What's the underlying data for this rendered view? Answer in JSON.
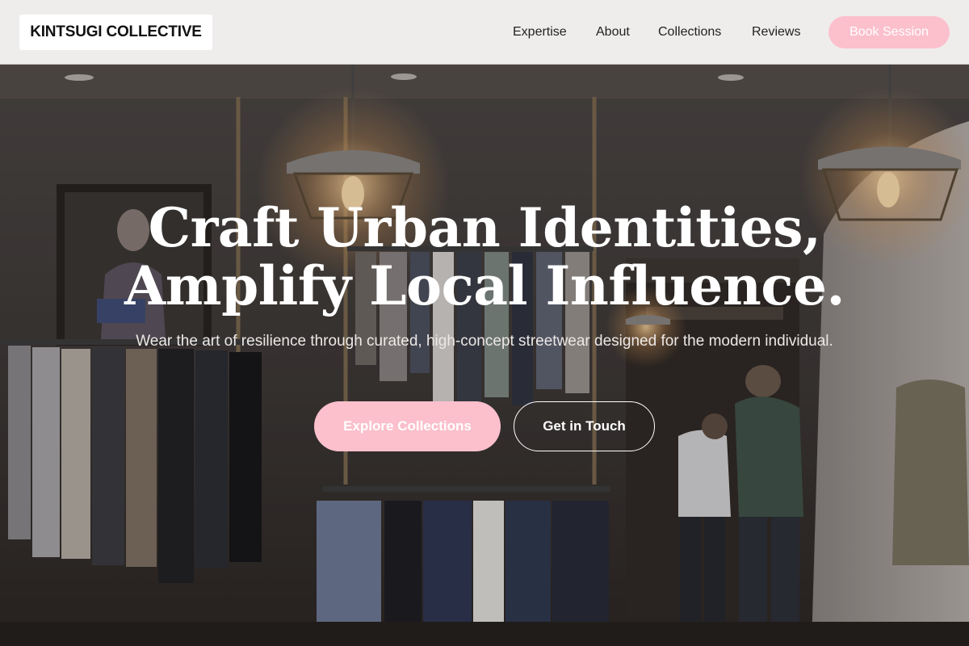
{
  "header": {
    "logo_text": "KINTSUGI COLLECTIVE",
    "nav": [
      {
        "label": "Expertise"
      },
      {
        "label": "About"
      },
      {
        "label": "Collections"
      },
      {
        "label": "Reviews"
      }
    ],
    "cta_label": "Book Session"
  },
  "hero": {
    "title_line1": "Craft Urban Identities,",
    "title_line2": "Amplify Local Influence.",
    "subtitle": "Wear the art of resilience through curated, high-concept streetwear designed for the modern individual.",
    "primary_button": "Explore Collections",
    "secondary_button": "Get in Touch"
  },
  "colors": {
    "accent_pink": "#fbc0cc",
    "header_bg": "#efedec",
    "text_dark": "#222222"
  }
}
